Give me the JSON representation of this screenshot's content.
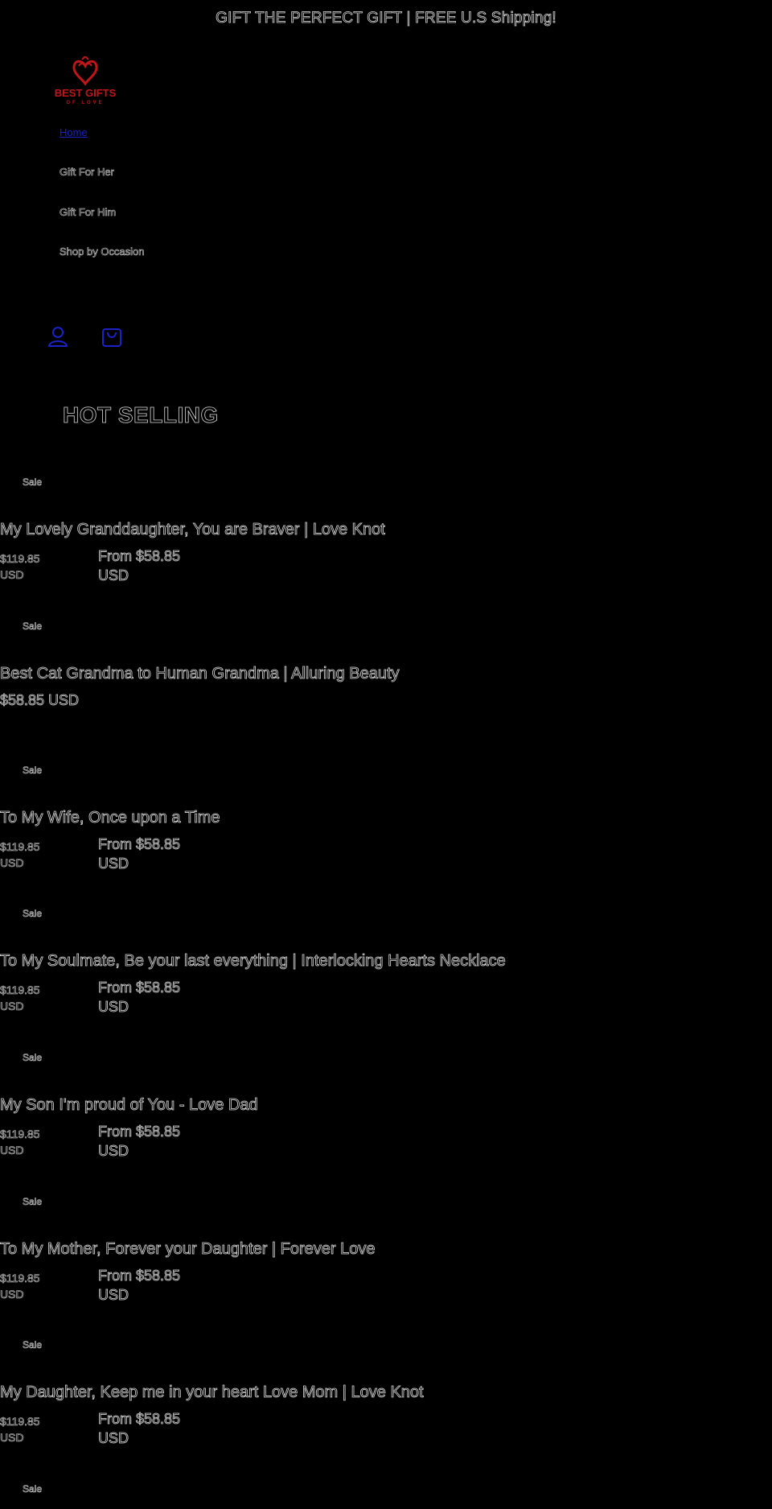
{
  "announcement": "GIFT THE PERFECT GIFT | FREE U.S Shipping!",
  "brand": {
    "logo_text": "BEST GIFTS",
    "logo_sub": "OF LOVE",
    "logo_color": "#c0161b"
  },
  "nav": {
    "items": [
      {
        "label": "Home",
        "active": true
      },
      {
        "label": "Gift For Her",
        "active": false
      },
      {
        "label": "Gift For Him",
        "active": false
      },
      {
        "label": "Shop by Occasion",
        "active": false
      }
    ]
  },
  "header_icons": {
    "account": "account-icon",
    "cart": "cart-icon",
    "accent_color": "#1a22c8"
  },
  "section_title": "HOT SELLING",
  "products": [
    {
      "badge": "Sale",
      "title": "My Lovely Granddaughter, You are Braver | Love Knot",
      "regular_price": "$119.85 USD",
      "sale_price": "From $58.85 USD"
    },
    {
      "badge": "Sale",
      "title": "Best Cat Grandma to Human Grandma | Alluring Beauty",
      "regular_price": "",
      "sale_price": "$58.85 USD"
    },
    {
      "badge": "Sale",
      "title": "To My Wife, Once upon a Time",
      "regular_price": "$119.85 USD",
      "sale_price": "From $58.85 USD"
    },
    {
      "badge": "Sale",
      "title": "To My Soulmate, Be your last everything | Interlocking Hearts Necklace",
      "regular_price": "$119.85 USD",
      "sale_price": "From $58.85 USD"
    },
    {
      "badge": "Sale",
      "title": "My Son I'm proud of You - Love Dad",
      "regular_price": "$119.85 USD",
      "sale_price": "From $58.85 USD"
    },
    {
      "badge": "Sale",
      "title": "To My Mother, Forever your Daughter | Forever Love",
      "regular_price": "$119.85 USD",
      "sale_price": "From $58.85 USD"
    },
    {
      "badge": "Sale",
      "title": "My Daughter, Keep me in your heart Love Mom | Love Knot",
      "regular_price": "$119.85 USD",
      "sale_price": "From $58.85 USD"
    },
    {
      "badge": "Sale",
      "title": "",
      "regular_price": "",
      "sale_price": ""
    }
  ]
}
